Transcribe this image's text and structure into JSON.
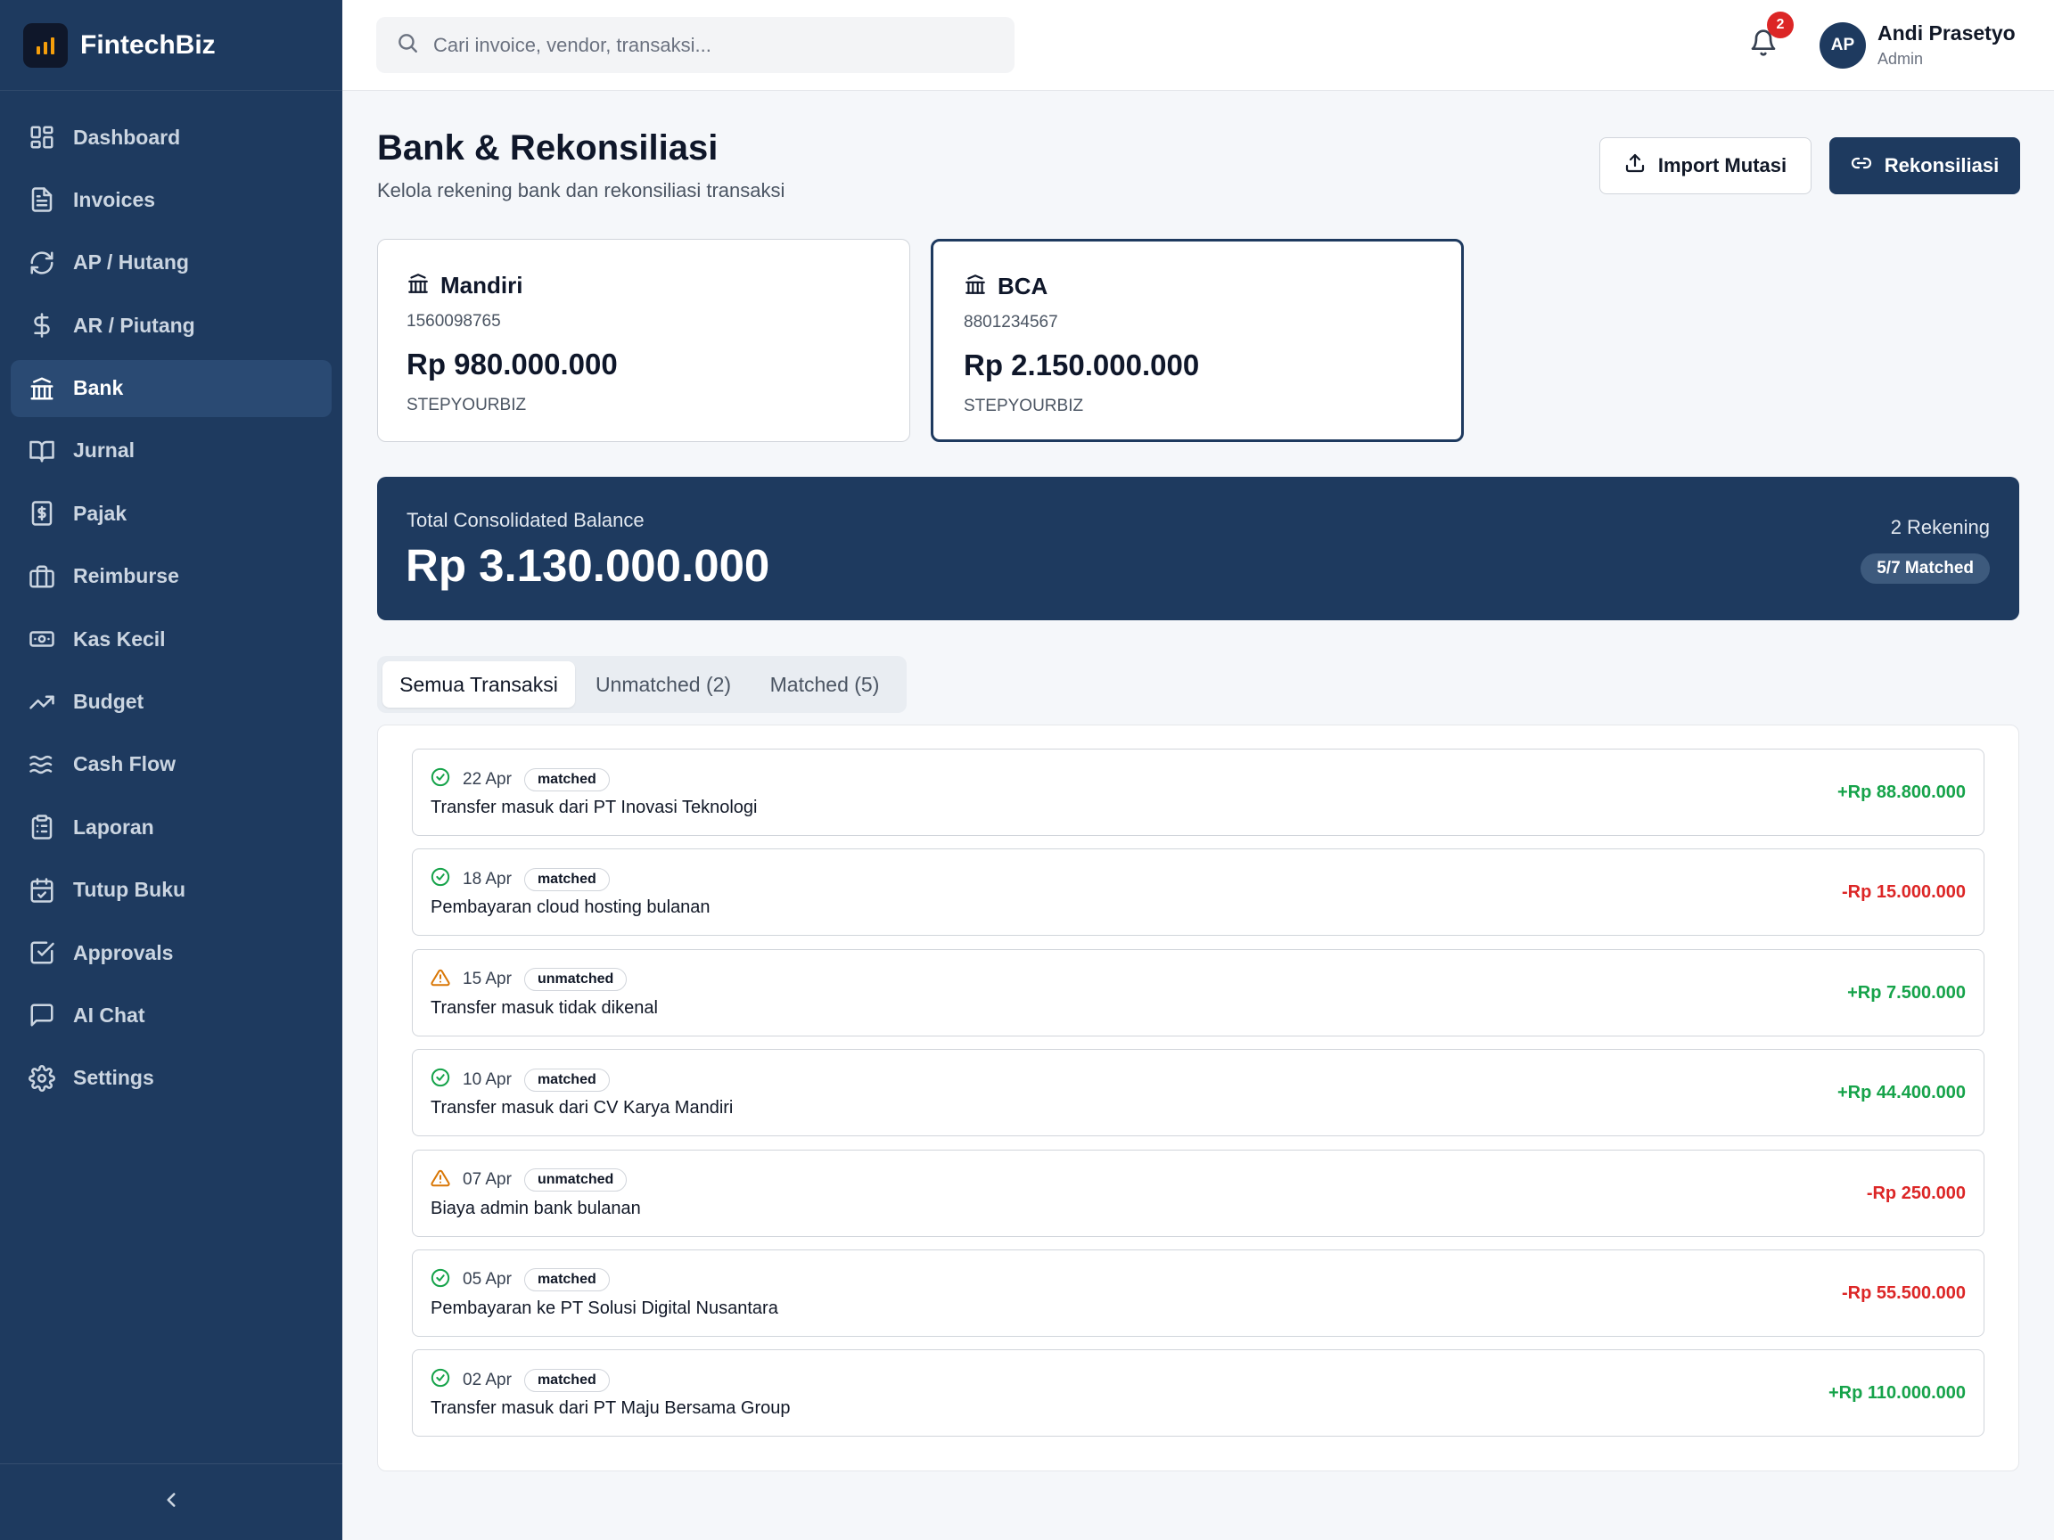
{
  "app": {
    "name": "FintechBiz"
  },
  "sidebar": {
    "items": [
      {
        "label": "Dashboard",
        "icon": "dashboard-icon"
      },
      {
        "label": "Invoices",
        "icon": "file-text-icon"
      },
      {
        "label": "AP / Hutang",
        "icon": "refresh-icon"
      },
      {
        "label": "AR / Piutang",
        "icon": "dollar-icon"
      },
      {
        "label": "Bank",
        "icon": "bank-icon",
        "active": true
      },
      {
        "label": "Jurnal",
        "icon": "book-icon"
      },
      {
        "label": "Pajak",
        "icon": "receipt-icon"
      },
      {
        "label": "Reimburse",
        "icon": "briefcase-icon"
      },
      {
        "label": "Kas Kecil",
        "icon": "cash-icon"
      },
      {
        "label": "Budget",
        "icon": "trending-up-icon"
      },
      {
        "label": "Cash Flow",
        "icon": "waves-icon"
      },
      {
        "label": "Laporan",
        "icon": "clipboard-icon"
      },
      {
        "label": "Tutup Buku",
        "icon": "calendar-check-icon"
      },
      {
        "label": "Approvals",
        "icon": "check-square-icon"
      },
      {
        "label": "AI Chat",
        "icon": "chat-icon"
      },
      {
        "label": "Settings",
        "icon": "gear-icon"
      }
    ],
    "collapse_icon": "chevron-left-icon"
  },
  "topbar": {
    "search_placeholder": "Cari invoice, vendor, transaksi...",
    "notification_count": "2",
    "user": {
      "initials": "AP",
      "name": "Andi Prasetyo",
      "role": "Admin"
    }
  },
  "header": {
    "title": "Bank & Rekonsiliasi",
    "subtitle": "Kelola rekening bank dan rekonsiliasi transaksi",
    "import_label": "Import Mutasi",
    "reconcile_label": "Rekonsiliasi"
  },
  "accounts": [
    {
      "name": "Mandiri",
      "number": "1560098765",
      "balance": "Rp 980.000.000",
      "holder": "STEPYOURBIZ"
    },
    {
      "name": "BCA",
      "number": "8801234567",
      "balance": "Rp 2.150.000.000",
      "holder": "STEPYOURBIZ",
      "selected": true
    }
  ],
  "summary": {
    "label": "Total Consolidated Balance",
    "total": "Rp 3.130.000.000",
    "account_count": "2 Rekening",
    "matched": "5/7 Matched"
  },
  "tabs": [
    {
      "label": "Semua Transaksi",
      "active": true
    },
    {
      "label": "Unmatched (2)"
    },
    {
      "label": "Matched (5)"
    }
  ],
  "transactions": [
    {
      "date": "22 Apr",
      "status": "matched",
      "description": "Transfer masuk dari PT Inovasi Teknologi",
      "amount": "+Rp 88.800.000"
    },
    {
      "date": "18 Apr",
      "status": "matched",
      "description": "Pembayaran cloud hosting bulanan",
      "amount": "-Rp 15.000.000"
    },
    {
      "date": "15 Apr",
      "status": "unmatched",
      "description": "Transfer masuk tidak dikenal",
      "amount": "+Rp 7.500.000"
    },
    {
      "date": "10 Apr",
      "status": "matched",
      "description": "Transfer masuk dari CV Karya Mandiri",
      "amount": "+Rp 44.400.000"
    },
    {
      "date": "07 Apr",
      "status": "unmatched",
      "description": "Biaya admin bank bulanan",
      "amount": "-Rp 250.000"
    },
    {
      "date": "05 Apr",
      "status": "matched",
      "description": "Pembayaran ke PT Solusi Digital Nusantara",
      "amount": "-Rp 55.500.000"
    },
    {
      "date": "02 Apr",
      "status": "matched",
      "description": "Transfer masuk dari PT Maju Bersama Group",
      "amount": "+Rp 110.000.000"
    }
  ],
  "colors": {
    "sidebar_bg": "#1e3a5f",
    "accent": "#1e3a5f",
    "positive": "#16a34a",
    "negative": "#dc2626",
    "warning": "#d97706",
    "badge": "#dc2626"
  }
}
